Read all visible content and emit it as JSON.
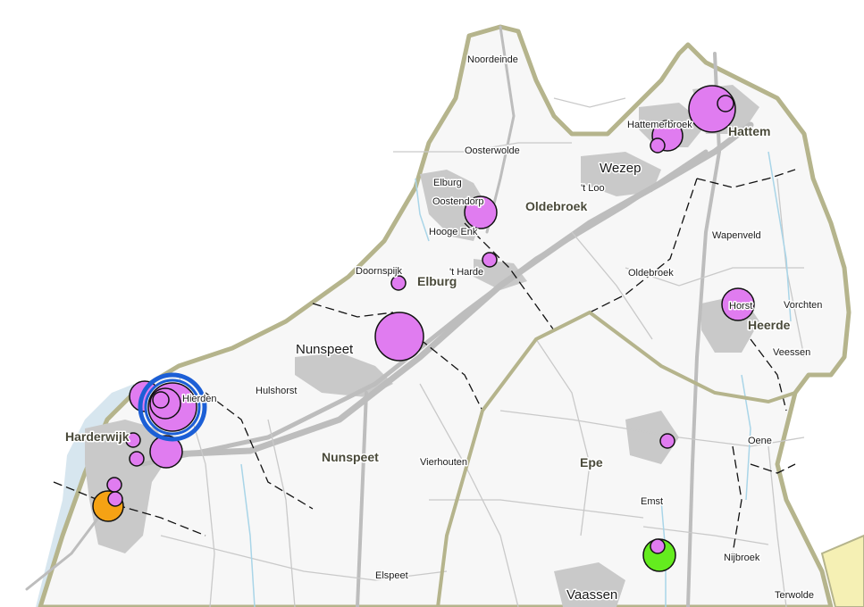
{
  "colors": {
    "land": "#f7f7f7",
    "water": "#d7e6ef",
    "urban": "#c9c9c9",
    "border": "#b5b48c",
    "road": "#bdbdbd",
    "marker_default": "#e07cf0",
    "marker_orange": "#f5a214",
    "marker_green": "#64ec1e",
    "selected_ring": "#1c5fd6",
    "east_region": "#f5f0b4"
  },
  "municipalities": [
    {
      "id": "nunspeet",
      "name": "Nunspeet"
    },
    {
      "id": "elburg",
      "name": "Elburg"
    },
    {
      "id": "oldebroek",
      "name": "Oldebroek"
    },
    {
      "id": "hattem",
      "name": "Hattem"
    },
    {
      "id": "heerde",
      "name": "Heerde"
    },
    {
      "id": "epe",
      "name": "Epe"
    },
    {
      "id": "harderwijk",
      "name": "Harderwijk"
    }
  ],
  "places": [
    {
      "id": "noordeinde",
      "name": "Noordeinde"
    },
    {
      "id": "oosterwolde",
      "name": "Oosterwolde"
    },
    {
      "id": "elburg-town",
      "name": "Elburg"
    },
    {
      "id": "oostendorp",
      "name": "Oostendorp"
    },
    {
      "id": "hooge-enk",
      "name": "Hooge Enk"
    },
    {
      "id": "t-loo",
      "name": "'t Loo"
    },
    {
      "id": "wezep",
      "name": "Wezep"
    },
    {
      "id": "hattemerbroek",
      "name": "Hattemerbroek"
    },
    {
      "id": "wapenveld",
      "name": "Wapenveld"
    },
    {
      "id": "doornspijk",
      "name": "Doornspijk"
    },
    {
      "id": "t-harde",
      "name": "'t Harde"
    },
    {
      "id": "oldebroek-town",
      "name": "Oldebroek"
    },
    {
      "id": "horst",
      "name": "Horst"
    },
    {
      "id": "vorchten",
      "name": "Vorchten"
    },
    {
      "id": "nunspeet-town",
      "name": "Nunspeet"
    },
    {
      "id": "veessen",
      "name": "Veessen"
    },
    {
      "id": "hierden",
      "name": "Hierden"
    },
    {
      "id": "hulshorst",
      "name": "Hulshorst"
    },
    {
      "id": "oene",
      "name": "Oene"
    },
    {
      "id": "vierhouten",
      "name": "Vierhouten"
    },
    {
      "id": "emst",
      "name": "Emst"
    },
    {
      "id": "nijbroek",
      "name": "Nijbroek"
    },
    {
      "id": "elspeet",
      "name": "Elspeet"
    },
    {
      "id": "terwolde",
      "name": "Terwolde"
    },
    {
      "id": "vaassen",
      "name": "Vaassen"
    }
  ],
  "markers": [
    {
      "id": "m-hattem-large",
      "color": "marker_default",
      "size": "large"
    },
    {
      "id": "m-hattem-small",
      "color": "marker_default",
      "size": "small"
    },
    {
      "id": "m-hattemerbroek",
      "color": "marker_default",
      "size": "medium"
    },
    {
      "id": "m-hattemerbroek-small",
      "color": "marker_default",
      "size": "small"
    },
    {
      "id": "m-oostendorp",
      "color": "marker_default",
      "size": "medium"
    },
    {
      "id": "m-t-harde",
      "color": "marker_default",
      "size": "small"
    },
    {
      "id": "m-doornspijk",
      "color": "marker_default",
      "size": "small"
    },
    {
      "id": "m-horst",
      "color": "marker_default",
      "size": "medium"
    },
    {
      "id": "m-nunspeet",
      "color": "marker_default",
      "size": "large"
    },
    {
      "id": "m-harderwijk-a",
      "color": "marker_default",
      "size": "medium"
    },
    {
      "id": "m-harderwijk-selected",
      "color": "marker_default",
      "size": "large",
      "selected": true
    },
    {
      "id": "m-harderwijk-b",
      "color": "marker_default",
      "size": "small"
    },
    {
      "id": "m-harderwijk-c",
      "color": "marker_default",
      "size": "small"
    },
    {
      "id": "m-harderwijk-d",
      "color": "marker_default",
      "size": "medium"
    },
    {
      "id": "m-harderwijk-e",
      "color": "marker_default",
      "size": "small"
    },
    {
      "id": "m-harderwijk-orange",
      "color": "marker_orange",
      "size": "medium"
    },
    {
      "id": "m-harderwijk-f",
      "color": "marker_default",
      "size": "small"
    },
    {
      "id": "m-epe",
      "color": "marker_default",
      "size": "small"
    },
    {
      "id": "m-emst-green",
      "color": "marker_green",
      "size": "medium"
    },
    {
      "id": "m-emst-small",
      "color": "marker_default",
      "size": "small"
    }
  ]
}
